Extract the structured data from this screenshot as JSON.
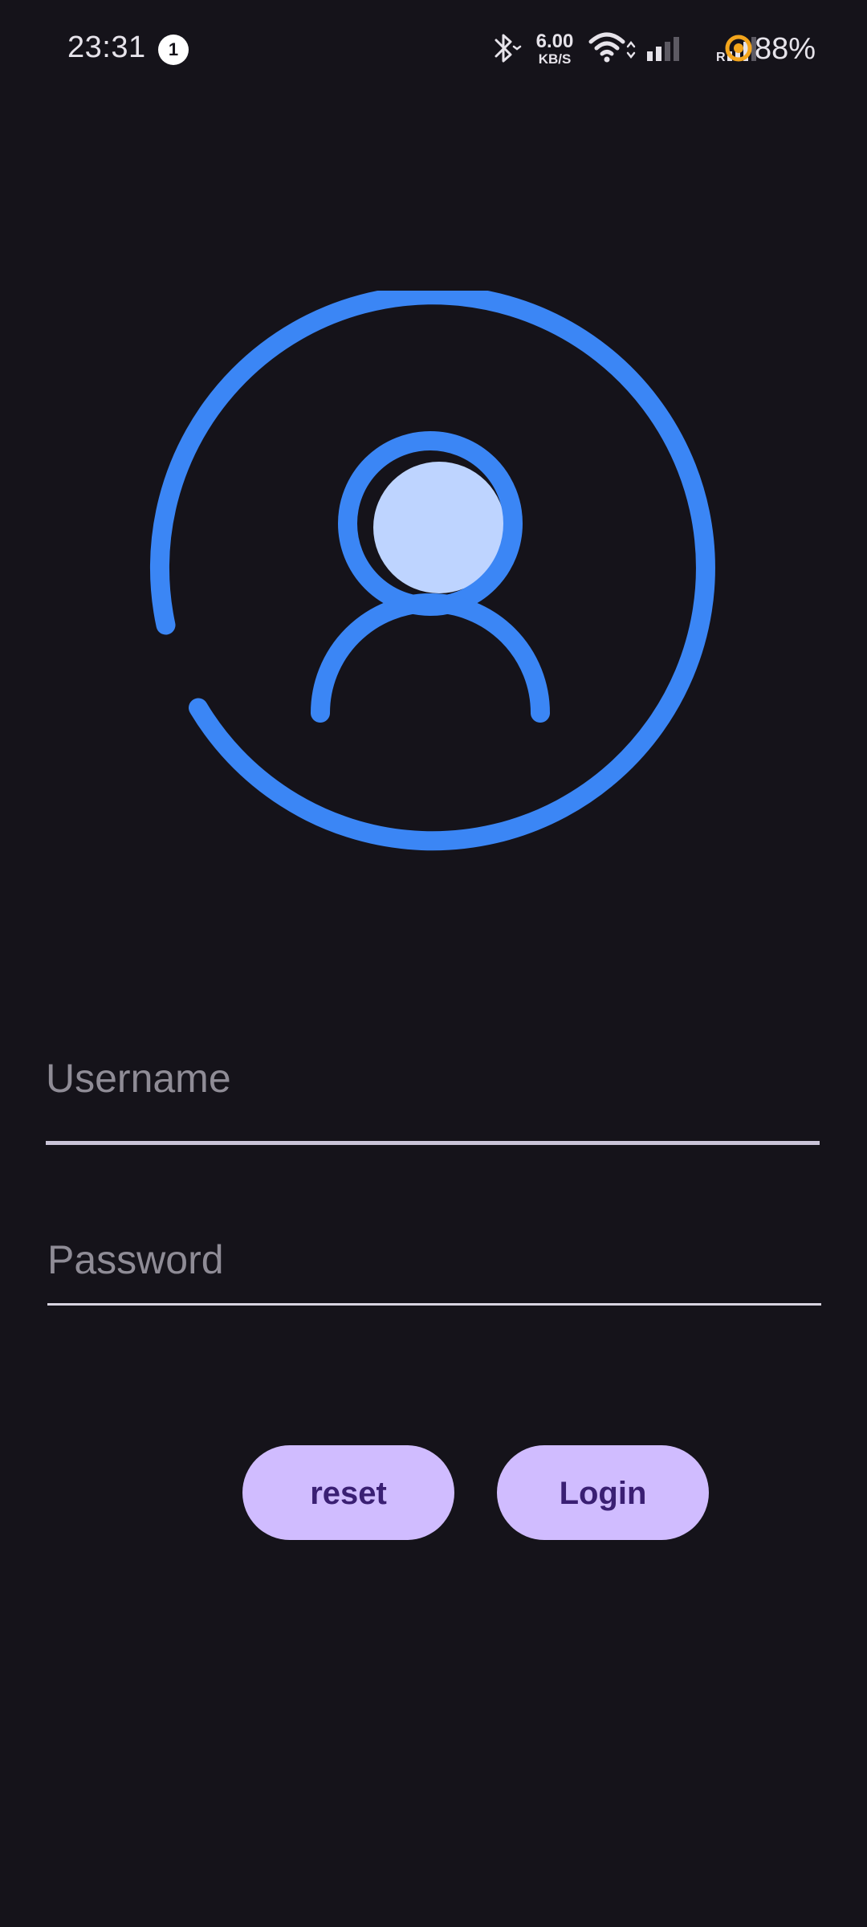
{
  "status_bar": {
    "time": "23:31",
    "notification_count": "1",
    "net_speed_value": "6.00",
    "net_speed_unit": "KB/S",
    "roaming": "R",
    "battery": "88%",
    "icons": [
      "bluetooth-icon",
      "wifi-icon",
      "signal-icon",
      "signal-icon",
      "battery-icon"
    ]
  },
  "avatar": {
    "icon": "user-account-icon",
    "ring_color": "#3b86f5",
    "head_fill_color": "#bed4ff"
  },
  "form": {
    "username_placeholder": "Username",
    "password_placeholder": "Password"
  },
  "buttons": {
    "reset_label": "reset",
    "login_label": "Login",
    "color": "#d0bcff",
    "text_color": "#3a1f73"
  },
  "colors": {
    "background": "#15131a",
    "accent": "#3b86f5"
  }
}
